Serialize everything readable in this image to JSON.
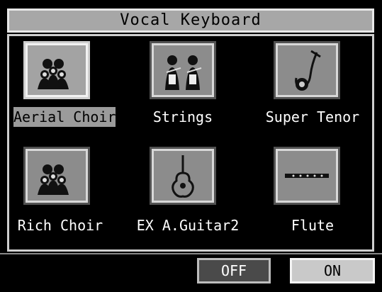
{
  "screen": {
    "title": "Vocal Keyboard"
  },
  "instruments": [
    {
      "label": "Aerial Choir",
      "icon": "choir-icon",
      "selected": true
    },
    {
      "label": "Strings",
      "icon": "strings-players-icon",
      "selected": false
    },
    {
      "label": "Super Tenor",
      "icon": "saxophone-icon",
      "selected": false
    },
    {
      "label": "Rich Choir",
      "icon": "choir-icon",
      "selected": false
    },
    {
      "label": "EX A.Guitar2",
      "icon": "acoustic-guitar-icon",
      "selected": false
    },
    {
      "label": "Flute",
      "icon": "flute-icon",
      "selected": false
    }
  ],
  "buttons": {
    "off": "OFF",
    "on": "ON"
  }
}
